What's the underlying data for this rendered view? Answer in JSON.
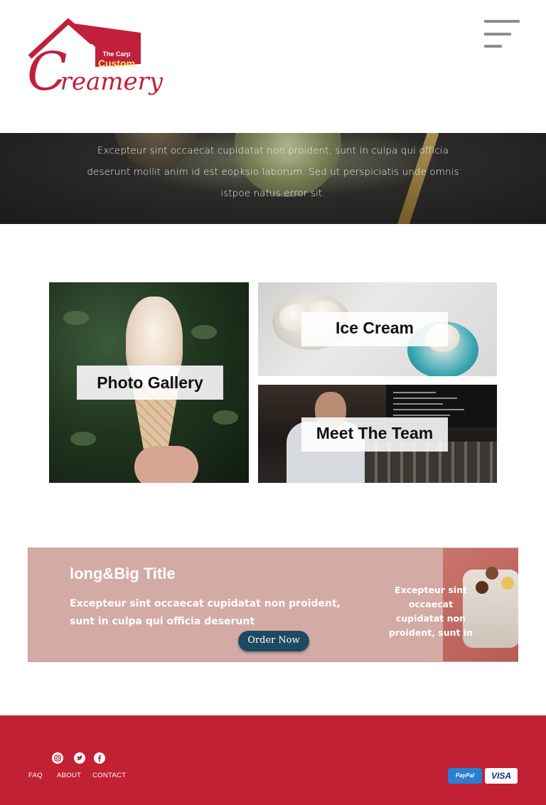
{
  "header": {
    "logo": {
      "tagline": "The Carp",
      "brand": "Custom",
      "script_initial": "C",
      "script_rest": "reamery"
    },
    "menu_icon": "hamburger-menu-icon"
  },
  "hero": {
    "text": "Excepteur sint occaecat cupidatat non proident, sunt in culpa qui officia deserunt mollit anim id est eopksio laborum. Sed ut perspiciatis unde omnis istpoe natus error sit."
  },
  "tiles": {
    "gallery": "Photo Gallery",
    "ice_cream": "Ice Cream",
    "team": "Meet The Team"
  },
  "promo": {
    "title": "long&Big Title",
    "description": "Excepteur sint occaecat cupidatat non proident, sunt in culpa qui officia deserunt",
    "button": "Order Now",
    "side_text": "Excepteur sint occaecat cupidatat non proident, sunt in"
  },
  "footer": {
    "social_icons": [
      "instagram-icon",
      "twitter-icon",
      "facebook-icon"
    ],
    "links": [
      "FAQ",
      "ABOUT",
      "CONTACT"
    ],
    "payments": {
      "paypal": "PayPal",
      "visa": "VISA"
    }
  },
  "colors": {
    "brand_red": "#c22033",
    "promo_bg": "#d4aaa5",
    "button_navy": "#1d4a63",
    "menu_gray": "#8c8c8c"
  }
}
